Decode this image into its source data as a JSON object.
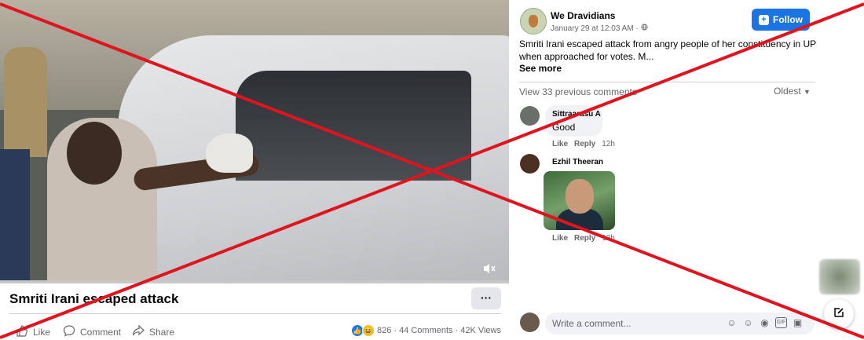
{
  "video": {
    "title": "Smriti Irani escaped attack",
    "more_label": "···",
    "progress_fraction": 0.0
  },
  "actions": {
    "like": "Like",
    "comment": "Comment",
    "share": "Share"
  },
  "stats": {
    "reactions": "826",
    "comments": "44 Comments",
    "views": "42K Views",
    "sep": "·"
  },
  "post": {
    "page_name": "We Dravidians",
    "date": "January 29 at 12:03 AM ·",
    "follow_label": "Follow",
    "text": "Smriti Irani escaped attack from angry people of her constituency in UP when approached for votes. M...",
    "see_more": "See more"
  },
  "comments_header": {
    "view_previous": "View 33 previous comments",
    "sort": "Oldest"
  },
  "comments": [
    {
      "name": "Sittraarasu A",
      "text": "Good",
      "like": "Like",
      "reply": "Reply",
      "time": "12h"
    },
    {
      "name": "Ezhil Theeran",
      "text": "",
      "like": "Like",
      "reply": "Reply",
      "time": "12h"
    }
  ],
  "composer": {
    "placeholder": "Write a comment..."
  },
  "colors": {
    "accent": "#1b74e4",
    "cross": "#e0141e"
  },
  "icons": [
    "like-icon",
    "comment-icon",
    "share-icon",
    "globe-icon",
    "follow-icon",
    "chevron-down-icon",
    "mute-icon",
    "edit-icon",
    "sticker-icon",
    "emoji-icon",
    "camera-icon",
    "gif-icon",
    "avatar-sticker-icon"
  ]
}
